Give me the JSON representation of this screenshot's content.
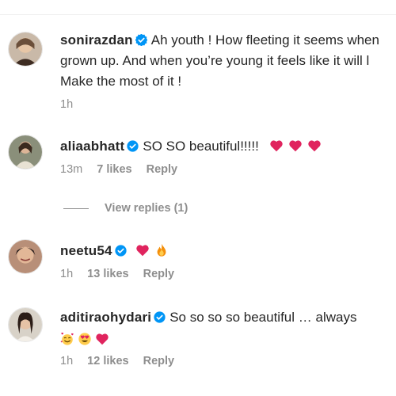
{
  "comments": [
    {
      "username": "sonirazdan",
      "text_lines": [
        "Ah youth ! How fleeting it seems when",
        "grown up. And when you’re young it feels like it will l",
        "Make the most of it !"
      ],
      "time": "1h"
    },
    {
      "username": "aliaabhatt",
      "text": "SO SO beautiful!!!!!",
      "emojis": [
        "red-heart",
        "red-heart",
        "red-heart"
      ],
      "time": "13m",
      "likes": "7 likes",
      "reply_label": "Reply"
    },
    {
      "username": "neetu54",
      "emojis": [
        "red-heart",
        "fire"
      ],
      "time": "1h",
      "likes": "13 likes",
      "reply_label": "Reply"
    },
    {
      "username": "aditiraohydari",
      "text": "So so so so beautiful … always",
      "emojis": [
        "smiling-face-with-hearts",
        "heart-eyes",
        "red-heart"
      ],
      "time": "1h",
      "likes": "12 likes",
      "reply_label": "Reply"
    }
  ],
  "view_replies": "View replies (1)",
  "colors": {
    "text": "#262626",
    "secondary": "#8e8e8e",
    "verified": "#0095f6",
    "heart": "#e0245e"
  }
}
